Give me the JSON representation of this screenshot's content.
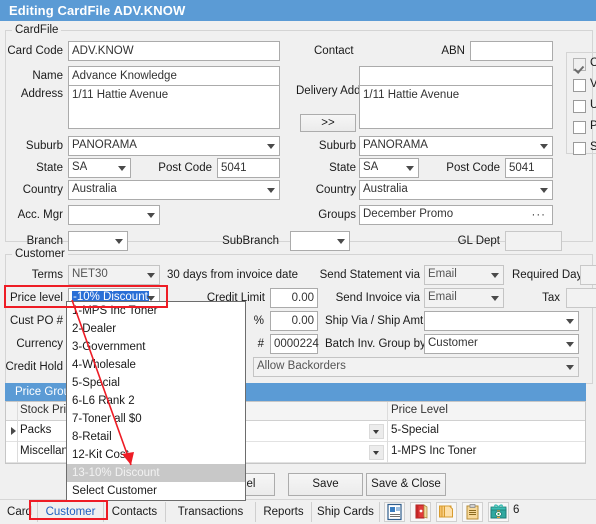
{
  "window": {
    "title": "Editing CardFile ADV.KNOW",
    "title_bg": "#5b9bd5"
  },
  "groups": {
    "cardfile": "CardFile",
    "customer": "Customer",
    "price_groups": "Price Groups"
  },
  "cardfile": {
    "labels": {
      "card_code": "Card Code",
      "name": "Name",
      "address": "Address",
      "suburb": "Suburb",
      "state": "State",
      "post_code": "Post Code",
      "country": "Country",
      "acc_mgr": "Acc. Mgr",
      "contact": "Contact",
      "abn": "ABN",
      "delivery_address": "Delivery Address",
      "copy_button": ">>",
      "groups": "Groups",
      "branch": "Branch",
      "subbranch": "SubBranch",
      "gl_dept": "GL Dept"
    },
    "values": {
      "card_code": "ADV.KNOW",
      "name": "Advance Knowledge",
      "address": "1/11 Hattie Avenue",
      "suburb": "PANORAMA",
      "state": "SA",
      "post_code": "5041",
      "country": "Australia",
      "acc_mgr": "",
      "contact": "",
      "abn": "",
      "delivery_address": "1/11 Hattie Avenue",
      "delivery_suburb": "PANORAMA",
      "delivery_state": "SA",
      "delivery_post_code": "5041",
      "delivery_country": "Australia",
      "groups": "December Promo",
      "groups_ellipsis": "···",
      "branch": "",
      "subbranch": "",
      "gl_dept": ""
    }
  },
  "flags": [
    {
      "label": "C",
      "checked": true
    },
    {
      "label": "V",
      "checked": false
    },
    {
      "label": "U",
      "checked": false
    },
    {
      "label": "P",
      "checked": false
    },
    {
      "label": "S",
      "checked": false
    }
  ],
  "customer": {
    "labels": {
      "terms": "Terms",
      "terms_note": "30 days from invoice date",
      "price_level": "Price level",
      "credit_limit": "Credit Limit",
      "cust_po": "Cust PO #",
      "percent": "%",
      "currency": "Currency",
      "hash": "#",
      "credit_hold": "Credit Hold",
      "send_statement_via": "Send Statement via",
      "required_days": "Required Days",
      "send_invoice_via": "Send Invoice via",
      "tax": "Tax",
      "ship_via": "Ship Via / Ship Amt.",
      "batch_inv_group_by": "Batch Inv. Group by"
    },
    "values": {
      "terms": "NET30",
      "price_level": "-10% Discount",
      "credit_limit": "0.00",
      "cust_po": "",
      "percent": "0.00",
      "currency": "",
      "hash": "0000224",
      "credit_hold": "",
      "backorders": "Allow Backorders",
      "send_statement_via": "Email",
      "required_days": "",
      "send_invoice_via": "Email",
      "tax": "",
      "ship_via": "",
      "batch_inv_group_by": "Customer"
    }
  },
  "price_level_dropdown": {
    "open": true,
    "selected": "13-10% Discount",
    "items": [
      "1-MPS Inc Toner",
      "2-Dealer",
      "3-Government",
      "4-Wholesale",
      "5-Special",
      "6-L6 Rank 2",
      "7-Toner all $0",
      "8-Retail",
      "12-Kit Cost",
      "13-10% Discount",
      "Select Customer"
    ]
  },
  "price_groups_grid": {
    "columns": [
      "Stock Price Group",
      "",
      "Price Level"
    ],
    "rows": [
      {
        "stock_price_group": "Packs",
        "price_level": "5-Special",
        "current": true
      },
      {
        "stock_price_group": "Miscellaneous",
        "price_level": "1-MPS Inc Toner",
        "current": false
      }
    ]
  },
  "buttons": {
    "cancel": "Cancel",
    "save": "Save",
    "save_close": "Save & Close"
  },
  "tabs": [
    {
      "label": "Card",
      "active": false
    },
    {
      "label": "Customer",
      "active": true
    },
    {
      "label": "Contacts",
      "active": false
    },
    {
      "label": "Transactions",
      "active": false
    },
    {
      "label": "Reports",
      "active": false
    },
    {
      "label": "Ship Cards",
      "active": false
    }
  ],
  "toolbar_icons": [
    {
      "name": "card-details-icon"
    },
    {
      "name": "red-binder-icon"
    },
    {
      "name": "copy-pages-icon"
    },
    {
      "name": "clipboard-icon"
    },
    {
      "name": "gift-money-icon"
    }
  ],
  "toolbar_count": "6",
  "annotations": {
    "highlight_color": "#ee1c25"
  }
}
